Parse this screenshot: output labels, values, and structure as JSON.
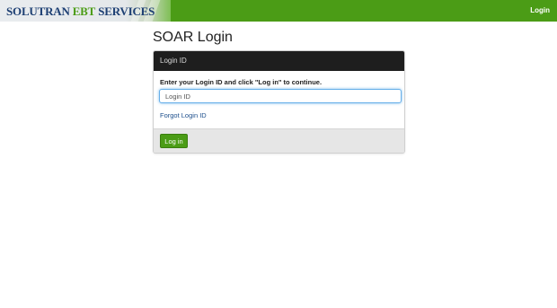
{
  "header": {
    "logo": {
      "part1": "SOLUTRAN",
      "part2": "EBT",
      "part3": "SERVICES"
    },
    "nav_login": "Login"
  },
  "page": {
    "title": "SOAR Login"
  },
  "panel": {
    "header": "Login ID",
    "instruction": "Enter your Login ID and click \"Log in\" to continue.",
    "input_placeholder": "Login ID",
    "input_value": "",
    "forgot_link": "Forgot Login ID",
    "button_label": "Log in"
  },
  "colors": {
    "brand_green": "#4b9c16",
    "brand_navy": "#1d3f73",
    "panel_header_bg": "#1e1e1e",
    "link": "#1d4f8c"
  }
}
